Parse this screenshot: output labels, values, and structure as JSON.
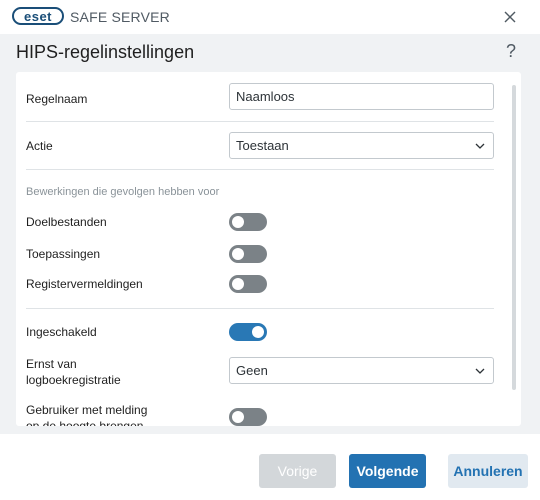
{
  "app": {
    "logo_text": "eset",
    "product_name": "SAFE SERVER"
  },
  "dialog": {
    "title": "HIPS-regelinstellingen",
    "help_label": "?"
  },
  "form": {
    "rule_name": {
      "label": "Regelnaam",
      "value": "Naamloos"
    },
    "action": {
      "label": "Actie",
      "value": "Toestaan"
    },
    "operations_hint": "Bewerkingen die gevolgen hebben voor",
    "target_files": {
      "label": "Doelbestanden",
      "enabled": false
    },
    "applications": {
      "label": "Toepassingen",
      "enabled": false
    },
    "registry_entries": {
      "label": "Registervermeldingen",
      "enabled": false
    },
    "enabled": {
      "label": "Ingeschakeld",
      "enabled": true
    },
    "log_severity": {
      "label_line1": "Ernst van",
      "label_line2": "logboekregistratie",
      "value": "Geen"
    },
    "notify_user": {
      "label_line1": "Gebruiker met melding",
      "label_line2": "op de hoogte brengen",
      "enabled": false
    }
  },
  "buttons": {
    "previous": "Vorige",
    "next": "Volgende",
    "cancel": "Annuleren"
  },
  "colors": {
    "accent": "#2372b2",
    "toggle_off": "#7b8287",
    "toggle_on": "#2978b5",
    "brand": "#1a4e78"
  }
}
